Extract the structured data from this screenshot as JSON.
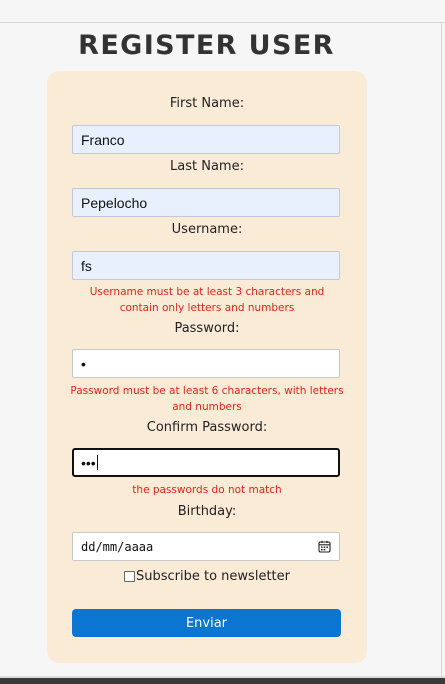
{
  "page": {
    "title": "REGISTER USER"
  },
  "form": {
    "first_name": {
      "label": "First Name:",
      "value": "Franco"
    },
    "last_name": {
      "label": "Last Name:",
      "value": "Pepelocho"
    },
    "username": {
      "label": "Username:",
      "value": "fs",
      "error_line1": "Username must be at least 3 characters and",
      "error_line2": "contain only letters and numbers"
    },
    "password": {
      "label": "Password:",
      "masked": "•",
      "error_line1": "Password must be at least 6 characters, with letters",
      "error_line2": "and numbers"
    },
    "confirm_password": {
      "label": "Confirm Password:",
      "masked": "•••",
      "error": "the passwords do not match"
    },
    "birthday": {
      "label": "Birthday:",
      "placeholder": "dd/mm/aaaa",
      "icon": "calendar-icon"
    },
    "newsletter": {
      "label": "Subscribe to newsletter",
      "checked": false
    },
    "submit_label": "Enviar"
  },
  "colors": {
    "card_background": "#faebd7",
    "autofill_background": "#e8f0fe",
    "error_text": "#e0261c",
    "button": "#0b76d1"
  }
}
